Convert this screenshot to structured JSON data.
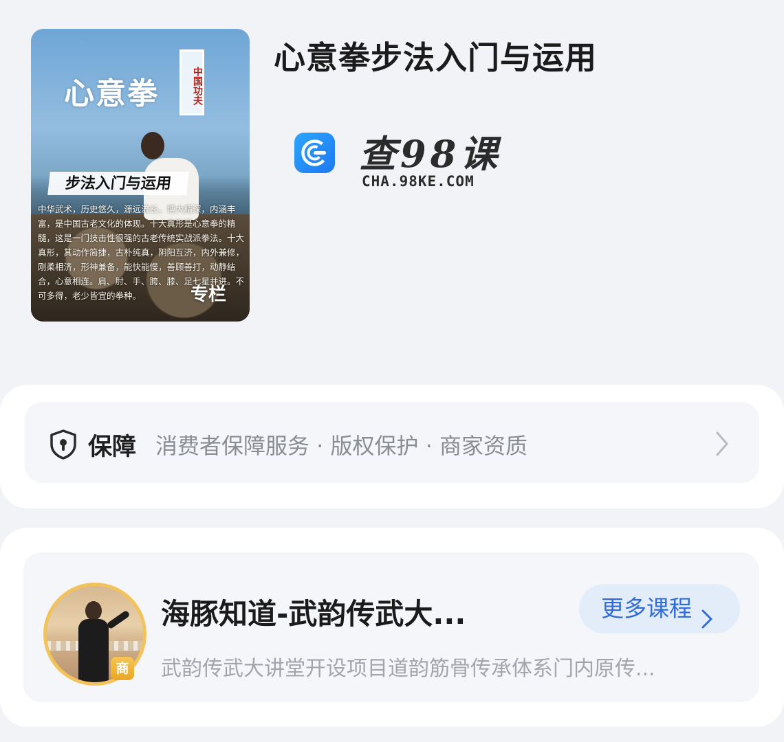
{
  "course": {
    "title": "心意拳步法入门与运用",
    "cover": {
      "calligraphy": "心意拳",
      "seal": "中国功夫",
      "subtitle": "步法入门与运用",
      "description": "中华武术，历史悠久，源远流长，博大精深，内涵丰富，是中国古老文化的体现。十大真形是心意拳的精髓，这是一门技击性很强的古老传统实战派拳法。十大真形，其动作简捷，古朴纯真，阴阳互济，内外兼修，刚柔相济，形神兼备，能快能慢，善顾善打，动静结合，心意相连。肩、肘、手、胯、膝、足七星并进。不可多得，老少皆宜的拳种。",
      "tag": "专栏"
    }
  },
  "watermark": {
    "text": "查98课",
    "url": "CHA.98KE.COM",
    "icon": "c-logo-icon",
    "color": "#1f78f0"
  },
  "guarantee": {
    "label": "保障",
    "items": "消费者保障服务 · 版权保护 · 商家资质",
    "icon": "shield-icon",
    "chevron": "chevron-right-icon"
  },
  "shop": {
    "name": "海豚知道-武韵传武大...",
    "description": "武韵传武大讲堂开设项目道韵筋骨传承体系门内原传...",
    "badge": "商",
    "more_label": "更多课程",
    "accent": "#2f6bd9",
    "badge_color": "#e9a824"
  }
}
